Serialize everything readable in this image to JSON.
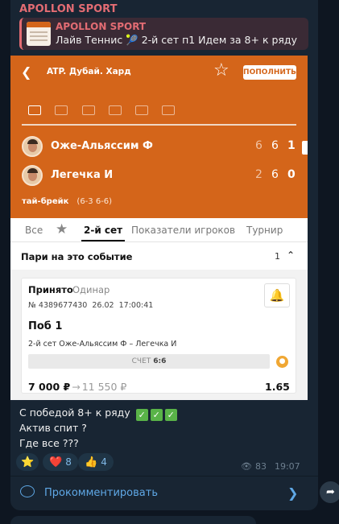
{
  "channel": {
    "name": "APOLLON SPORT"
  },
  "reply": {
    "title": "APOLLON SPORT",
    "text": "Лайв Теннис 🎾  2-й сет п1 Идем за 8+ к ряду"
  },
  "screenshot": {
    "league": "ATP. Дубай. Хард",
    "add_button": "ПОПОЛНИТЬ",
    "players": [
      {
        "name": "Оже-Альяссим Ф",
        "scores": [
          "6",
          "6",
          "1"
        ]
      },
      {
        "name": "Легечка И",
        "scores": [
          "2",
          "6",
          "0"
        ]
      }
    ],
    "tiebreak_label": "тай-брейк",
    "tiebreak_value": "(6-3 6-6)",
    "tabs": [
      "Все",
      "2-й сет",
      "Показатели игроков",
      "Турнир"
    ],
    "section": {
      "title": "Пари на это событие",
      "count": "1"
    },
    "bet": {
      "status": "Принято",
      "type": "Одинар",
      "number": "№ 4389677430",
      "date": "26.02",
      "time": "17:00:41",
      "outcome": "Поб 1",
      "event": "2-й сет Оже-Альяссим Ф – Легечка И",
      "score_label": "СЧЕТ",
      "score_value": "6:6",
      "stake": "7 000 ₽",
      "win": "11 550 ₽",
      "odds": "1.65"
    }
  },
  "message": {
    "line1": "С победой 8+ к ряду",
    "line2": "Актив спит ?",
    "line3": "Где все ???"
  },
  "reactions": [
    {
      "emoji": "⭐",
      "count": ""
    },
    {
      "emoji": "❤️",
      "count": "8"
    },
    {
      "emoji": "👍",
      "count": "4"
    }
  ],
  "meta": {
    "views": "83",
    "time": "19:07"
  },
  "comment_label": "Прокомментировать"
}
